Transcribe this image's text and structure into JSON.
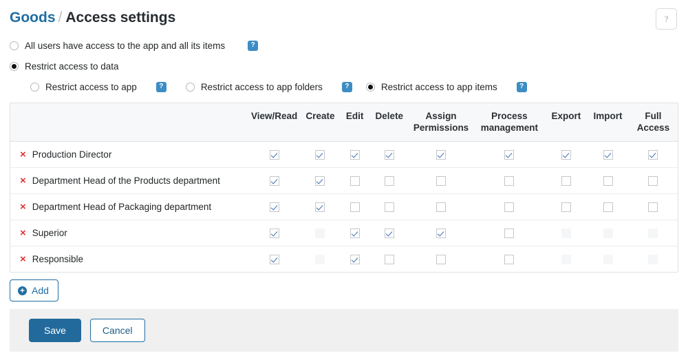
{
  "header": {
    "breadcrumb_app": "Goods",
    "breadcrumb_separator": "/",
    "breadcrumb_current": "Access settings",
    "help_button_glyph": "?"
  },
  "access_options": {
    "primary": [
      {
        "label": "All users have access to the app and all its items",
        "selected": false,
        "has_help": true
      },
      {
        "label": "Restrict access to data",
        "selected": true,
        "has_help": false
      }
    ],
    "secondary": [
      {
        "label": "Restrict access to app",
        "selected": false,
        "has_help": true
      },
      {
        "label": "Restrict access to app folders",
        "selected": false,
        "has_help": true
      },
      {
        "label": "Restrict access to app items",
        "selected": true,
        "has_help": true
      }
    ],
    "help_badge_glyph": "?"
  },
  "table": {
    "role_column_header": "",
    "columns": [
      "View/Read",
      "Create",
      "Edit",
      "Delete",
      "Assign Permissions",
      "Process management",
      "Export",
      "Import",
      "Full Access"
    ],
    "rows": [
      {
        "role": "Production Director",
        "remove_glyph": "×",
        "states": [
          "checked",
          "checked",
          "checked",
          "checked",
          "checked",
          "checked",
          "checked",
          "checked",
          "checked"
        ]
      },
      {
        "role": "Department Head of the Products department",
        "remove_glyph": "×",
        "states": [
          "checked",
          "checked",
          "unchecked",
          "unchecked",
          "unchecked",
          "unchecked",
          "unchecked",
          "unchecked",
          "unchecked"
        ]
      },
      {
        "role": "Department Head of Packaging department",
        "remove_glyph": "×",
        "states": [
          "checked",
          "checked",
          "unchecked",
          "unchecked",
          "unchecked",
          "unchecked",
          "unchecked",
          "unchecked",
          "unchecked"
        ]
      },
      {
        "role": "Superior",
        "remove_glyph": "×",
        "states": [
          "checked",
          "disabled",
          "checked",
          "checked",
          "checked",
          "unchecked",
          "disabled",
          "disabled",
          "disabled"
        ]
      },
      {
        "role": "Responsible",
        "remove_glyph": "×",
        "states": [
          "checked",
          "disabled",
          "checked",
          "unchecked",
          "unchecked",
          "unchecked",
          "disabled",
          "disabled",
          "disabled"
        ]
      }
    ]
  },
  "actions": {
    "add_label": "Add",
    "add_icon_glyph": "+",
    "save_label": "Save",
    "cancel_label": "Cancel"
  },
  "colors": {
    "link_blue": "#1d6ea3",
    "badge_blue": "#3d8dc4",
    "save_blue": "#226a9c",
    "remove_red": "#e03131",
    "check_blue": "#3d6fb0",
    "header_bg": "#f7f8f9",
    "footer_bg": "#f0f0f0"
  }
}
